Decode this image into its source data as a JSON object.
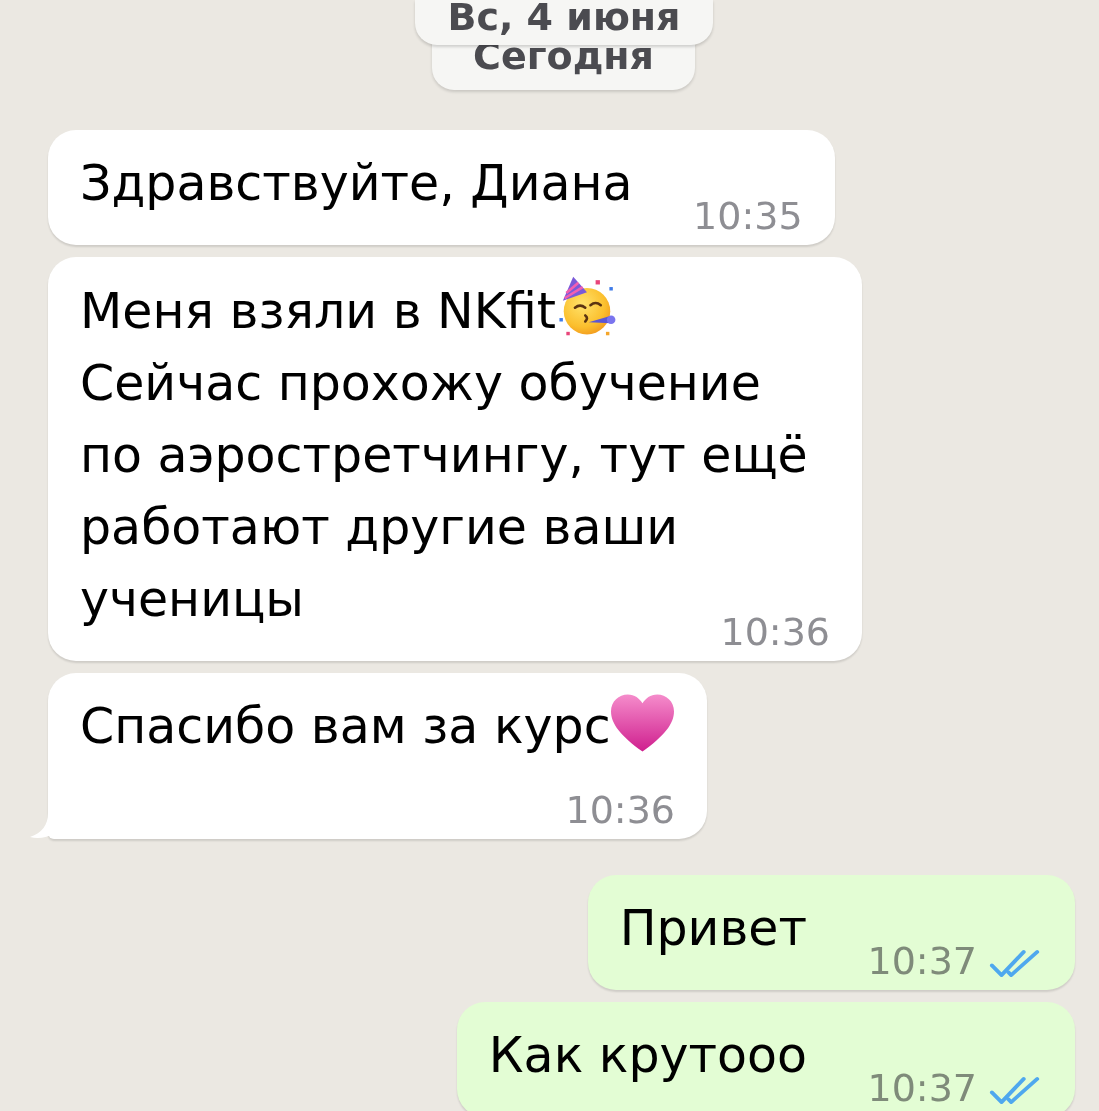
{
  "sticky_date": "Вс, 4 июня",
  "date_separator": "Сегодня",
  "messages": [
    {
      "kind": "incoming",
      "lines": [
        {
          "kind": "plain",
          "text": "Здравствуйте, Диана"
        }
      ],
      "time": "10:35",
      "tail": false
    },
    {
      "kind": "incoming",
      "lines": [
        {
          "kind": "party",
          "text": "Меня взяли в NKfit"
        },
        {
          "kind": "plain",
          "text": "Сейчас прохожу обучение по аэростретчингу, тут ещё работают другие ваши ученицы"
        }
      ],
      "time": "10:36",
      "tail": false
    },
    {
      "kind": "incoming",
      "lines": [
        {
          "kind": "heart",
          "text": "Спасибо вам за курс"
        }
      ],
      "time": "10:36",
      "tail": true
    },
    {
      "kind": "outgoing",
      "lines": [
        {
          "kind": "plain",
          "text": "Привет"
        }
      ],
      "time": "10:37",
      "read": true,
      "tail": false
    },
    {
      "kind": "outgoing",
      "lines": [
        {
          "kind": "plain",
          "text": "Как крутооо"
        }
      ],
      "time": "10:37",
      "read": true,
      "tail": false
    }
  ]
}
